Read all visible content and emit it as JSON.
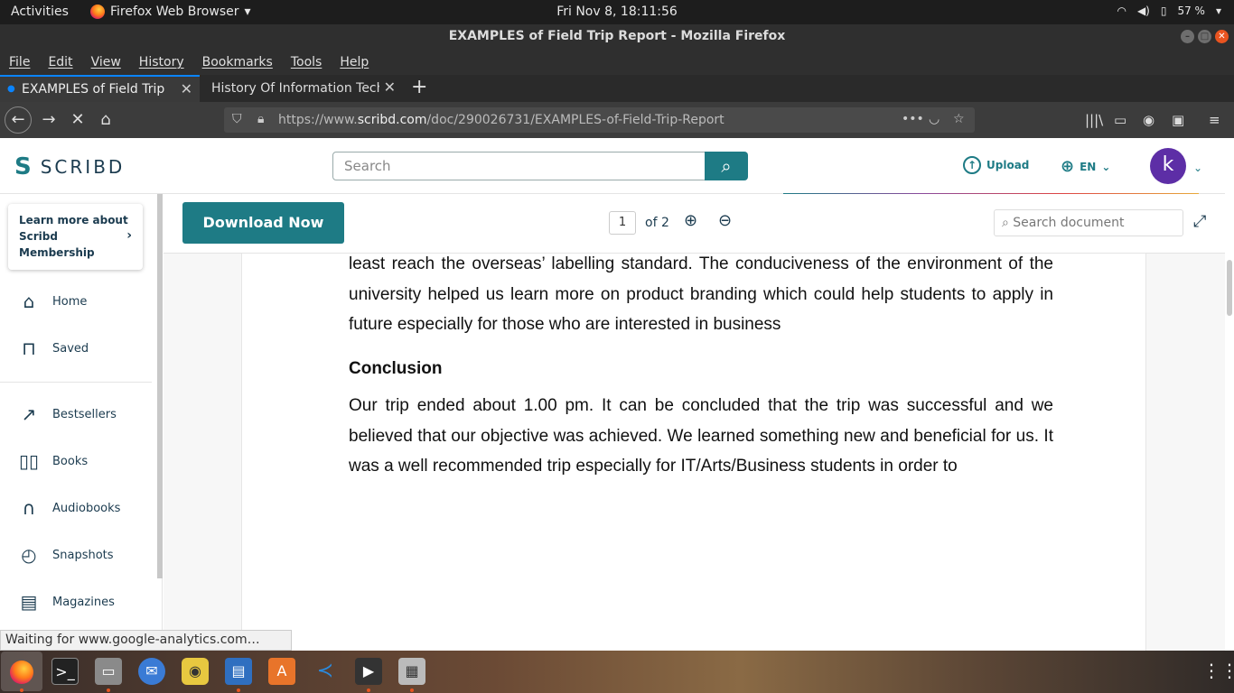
{
  "top_bar": {
    "activities": "Activities",
    "app_menu": "Firefox Web Browser",
    "clock": "Fri Nov  8, 18:11:56",
    "battery": "57 %"
  },
  "window": {
    "title": "EXAMPLES of Field Trip Report - Mozilla Firefox"
  },
  "menu": {
    "items": [
      "File",
      "Edit",
      "View",
      "History",
      "Bookmarks",
      "Tools",
      "Help"
    ]
  },
  "tabs": [
    {
      "label": "EXAMPLES of Field Trip Report",
      "active": true
    },
    {
      "label": "History Of Information Technology",
      "active": false
    }
  ],
  "url": {
    "prefix": "https://www.",
    "domain": "scribd.com",
    "path": "/doc/290026731/EXAMPLES-of-Field-Trip-Report"
  },
  "scribd": {
    "logo_text": "SCRIBD",
    "search_placeholder": "Search",
    "upload_label": "Upload",
    "language": "EN",
    "avatar_initial": "k",
    "brand_color": "#1e7b85"
  },
  "sidebar": {
    "learn_more": "Learn more about Scribd Membership",
    "items": [
      {
        "label": "Home",
        "icon": "home-icon"
      },
      {
        "label": "Saved",
        "icon": "bookmark-icon"
      },
      {
        "label": "Bestsellers",
        "icon": "trending-icon"
      },
      {
        "label": "Books",
        "icon": "book-icon"
      },
      {
        "label": "Audiobooks",
        "icon": "headphones-icon"
      },
      {
        "label": "Snapshots",
        "icon": "stopwatch-icon"
      },
      {
        "label": "Magazines",
        "icon": "magazine-icon"
      }
    ]
  },
  "doc_toolbar": {
    "download_label": "Download Now",
    "page_number": "1",
    "page_of": "of 2",
    "search_placeholder": "Search document"
  },
  "document": {
    "para1": "least reach the overseas’ labelling standard. The conduciveness of the environment of the university helped us learn more on product branding which could help students to apply in future especially for those who are interested in business",
    "heading": "Conclusion",
    "para2": "Our trip ended about 1.00 pm. It can be concluded that the trip was successful and we believed that our objective was achieved. We learned something new and beneficial for us. It was a well recommended trip especially for IT/Arts/Business students in order to"
  },
  "status": {
    "text": "Waiting for www.google-analytics.com…"
  }
}
